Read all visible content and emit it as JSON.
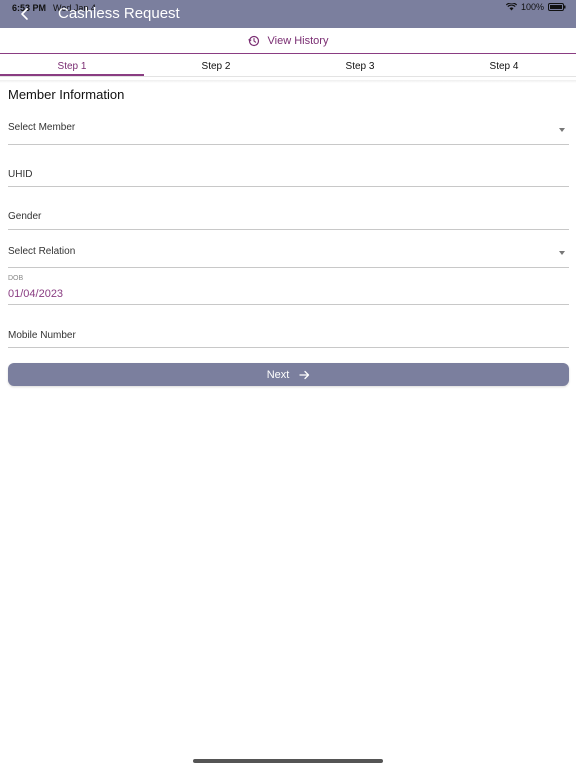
{
  "status_bar": {
    "time": "6:53 PM",
    "date": "Wed Jan 4",
    "battery": "100%"
  },
  "header": {
    "title": "Cashless Request",
    "back_icon": "chevron-left-icon"
  },
  "history": {
    "label": "View History",
    "icon": "history-icon"
  },
  "tabs": [
    {
      "label": "Step 1",
      "active": true
    },
    {
      "label": "Step 2",
      "active": false
    },
    {
      "label": "Step 3",
      "active": false
    },
    {
      "label": "Step 4",
      "active": false
    }
  ],
  "section_title": "Member Information",
  "fields": {
    "member": {
      "label": "Select Member"
    },
    "uhid": {
      "label": "UHID"
    },
    "gender": {
      "label": "Gender"
    },
    "relation": {
      "label": "Select Relation"
    },
    "dob": {
      "label": "DOB",
      "value": "01/04/2023"
    },
    "mobile": {
      "label": "Mobile Number"
    }
  },
  "next_button": {
    "label": "Next",
    "icon": "arrow-right-icon"
  },
  "colors": {
    "header_bg": "#7b7f9e",
    "accent": "#8a3d82",
    "button_bg": "#7b7f9e"
  }
}
